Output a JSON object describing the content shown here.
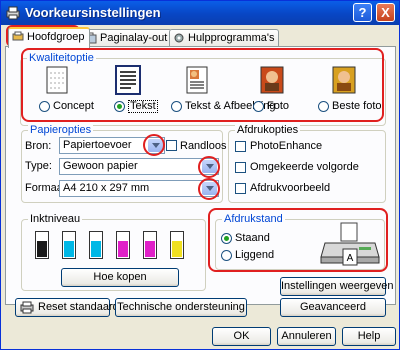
{
  "window": {
    "title": "Voorkeursinstellingen",
    "help_btn": "?",
    "close_btn": "X"
  },
  "tabs": [
    {
      "label": "Hoofdgroep"
    },
    {
      "label": "Paginalay-out"
    },
    {
      "label": "Hulpprogramma's"
    }
  ],
  "quality": {
    "group_label": "Kwaliteitoptie",
    "options": [
      {
        "label": "Concept",
        "icon": "draft-document-icon",
        "selected": false
      },
      {
        "label": "Tekst",
        "icon": "text-document-icon",
        "selected": true
      },
      {
        "label": "Tekst & Afbeelding",
        "icon": "text-image-document-icon",
        "selected": false
      },
      {
        "label": "Foto",
        "icon": "photo-icon",
        "selected": false
      },
      {
        "label": "Beste foto",
        "icon": "best-photo-icon",
        "selected": false
      }
    ]
  },
  "paper": {
    "group_label": "Papieropties",
    "source_label": "Bron:",
    "source_value": "Papiertoevoer",
    "borderless_label": "Randloos",
    "type_label": "Type:",
    "type_value": "Gewoon papier",
    "format_label": "Formaat:",
    "format_value": "A4 210 x 297 mm"
  },
  "print_options": {
    "group_label": "Afdrukopties",
    "photoenhance": "PhotoEnhance",
    "reverse_order": "Omgekeerde volgorde",
    "preview": "Afdrukvoorbeeld"
  },
  "ink": {
    "group_label": "Inktniveau",
    "levels": [
      {
        "color": "#1a1a1a",
        "level": 0.6
      },
      {
        "color": "#00b8e6",
        "level": 0.6
      },
      {
        "color": "#00b8e6",
        "level": 0.6
      },
      {
        "color": "#e020c8",
        "level": 0.6
      },
      {
        "color": "#e020c8",
        "level": 0.6
      },
      {
        "color": "#f0e020",
        "level": 0.6
      }
    ],
    "buy_button": "Hoe kopen"
  },
  "orientation": {
    "group_label": "Afdrukstand",
    "portrait": "Staand",
    "landscape": "Liggend",
    "selected": "portrait"
  },
  "buttons": {
    "settings_view": "Instellingen weergeven",
    "reset": "Reset standaard",
    "tech_support": "Technische ondersteuning",
    "advanced": "Geavanceerd",
    "ok": "OK",
    "cancel": "Annuleren",
    "help": "Help"
  },
  "colors": {
    "accent_red": "#e02020",
    "title_blue": "#0a5ee8",
    "label_blue": "#0046d5"
  }
}
